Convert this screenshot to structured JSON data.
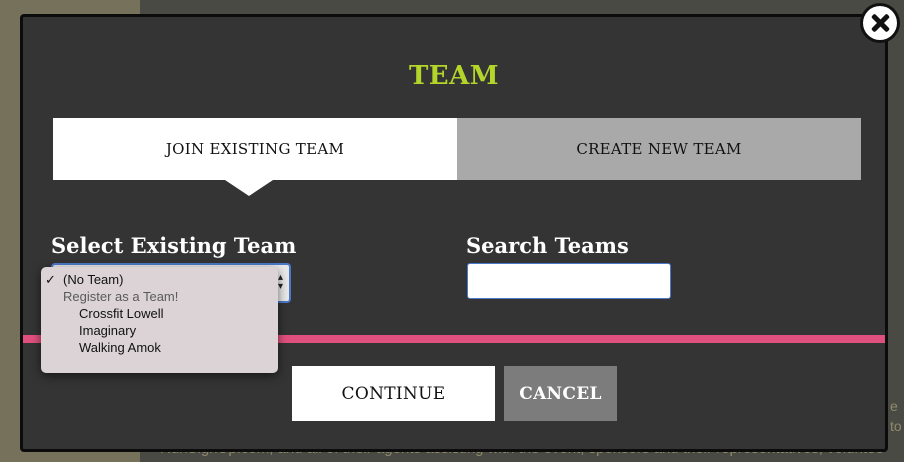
{
  "background": {
    "footer_text": "RunSignUp.com, and all of their agents assisting with the event, sponsors and their representatives, voluntee",
    "side_text_1": "e",
    "side_text_2": "to"
  },
  "modal": {
    "title": "TEAM",
    "close_icon": "close-icon",
    "tabs": [
      {
        "label": "JOIN EXISTING TEAM",
        "active": true
      },
      {
        "label": "CREATE NEW TEAM",
        "active": false
      }
    ],
    "select_label": "Select Existing Team",
    "search_label": "Search Teams",
    "search_value": "",
    "dropdown": {
      "selected": "(No Team)",
      "checkmark": "✓",
      "group_label": "Register as a Team!",
      "options": [
        "Crossfit Lowell",
        "Imaginary",
        "Walking Amok"
      ]
    },
    "continue_label": "CONTINUE",
    "cancel_label": "CANCEL"
  },
  "colors": {
    "title": "#b4d62a",
    "rule": "#e0507e",
    "focus": "#4a79c9"
  }
}
